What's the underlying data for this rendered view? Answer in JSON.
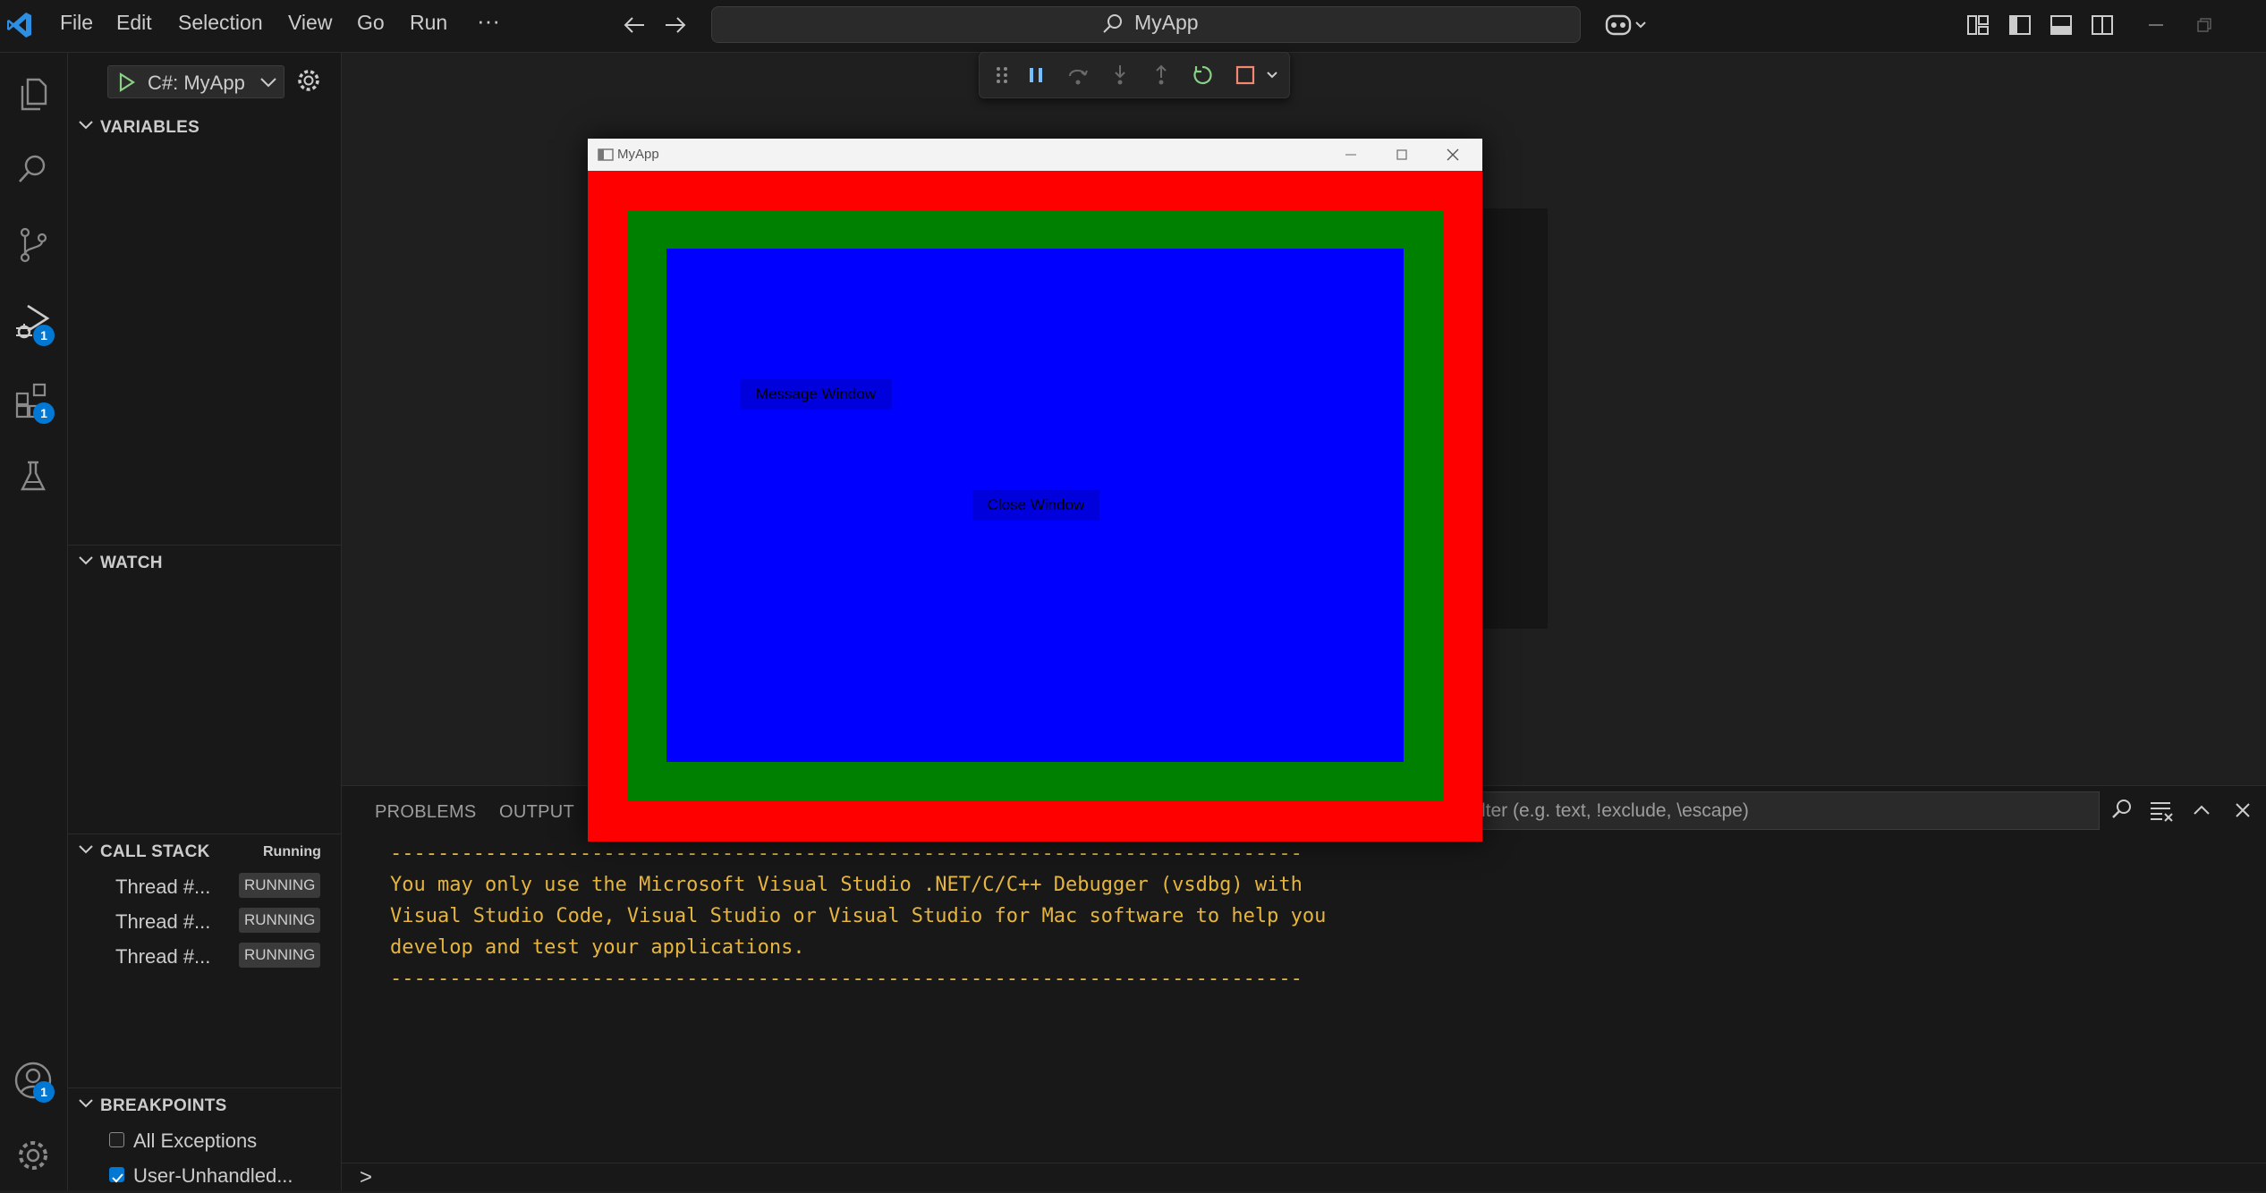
{
  "titlebar": {
    "menu": [
      "File",
      "Edit",
      "Selection",
      "View",
      "Go",
      "Run",
      "···"
    ],
    "search_text": "MyApp"
  },
  "activity_badges": {
    "run_debug": "1",
    "extensions": "1",
    "accounts": "1"
  },
  "sidebar": {
    "launch_config": "C#: MyApp",
    "variables_title": "VARIABLES",
    "watch_title": "WATCH",
    "call_stack_title": "CALL STACK",
    "call_stack_status": "Running",
    "threads": [
      {
        "name": "Thread #...",
        "status": "RUNNING"
      },
      {
        "name": "Thread #...",
        "status": "RUNNING"
      },
      {
        "name": "Thread #...",
        "status": "RUNNING"
      }
    ],
    "breakpoints_title": "BREAKPOINTS",
    "breakpoints": [
      {
        "label": "All Exceptions",
        "checked": false
      },
      {
        "label": "User-Unhandled...",
        "checked": true
      }
    ]
  },
  "panel": {
    "tabs": [
      "PROBLEMS",
      "OUTPUT"
    ],
    "filter_placeholder": "lter (e.g. text, !exclude, \\escape)",
    "terminal_lines": [
      "-----------------------------------------------------------------------------",
      "You may only use the Microsoft Visual Studio .NET/C/C++ Debugger (vsdbg) with",
      "Visual Studio Code, Visual Studio or Visual Studio for Mac software to help you",
      "develop and test your applications.",
      "-----------------------------------------------------------------------------"
    ],
    "prompt": ">"
  },
  "app_window": {
    "title": "MyApp",
    "message_button": "Message Window",
    "close_button": "Close Window"
  },
  "colors": {
    "accent": "#0078d4",
    "terminal_text": "#e5b53f",
    "app_outer": "#ff0000",
    "app_middle": "#008000",
    "app_inner": "#0000ff"
  }
}
